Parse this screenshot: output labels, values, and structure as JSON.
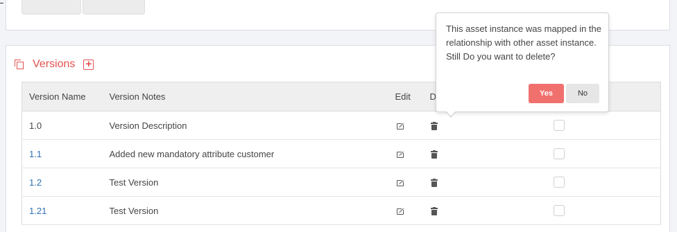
{
  "versions": {
    "title": "Versions",
    "columns": [
      "Version Name",
      "Version Notes",
      "Edit",
      "D"
    ],
    "rows": [
      {
        "name": "1.0",
        "notes": "Version Description",
        "is_link": false
      },
      {
        "name": "1.1",
        "notes": "Added new mandatory attribute customer",
        "is_link": true
      },
      {
        "name": "1.2",
        "notes": "Test Version",
        "is_link": true
      },
      {
        "name": "1.21",
        "notes": "Test Version",
        "is_link": true
      }
    ]
  },
  "popover": {
    "message": "This asset instance was mapped in the relationship with other asset instance. Still Do you want to delete?",
    "yes_label": "Yes",
    "no_label": "No"
  },
  "icons": {
    "section": "copy-icon",
    "add": "plus-square-icon",
    "edit": "edit-icon",
    "delete": "trash-icon"
  },
  "colors": {
    "accent": "#e2514f",
    "link": "#2f6fb5",
    "yes_button": "#f0706e",
    "no_button": "#e6e6e6"
  }
}
